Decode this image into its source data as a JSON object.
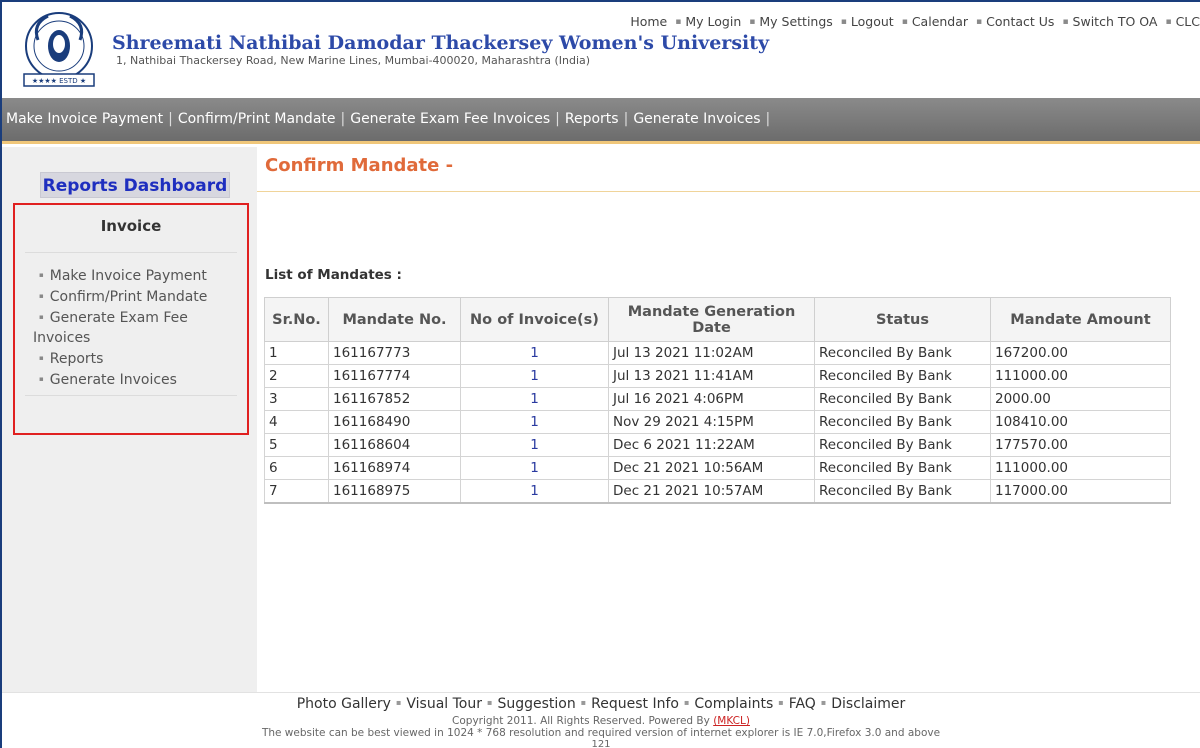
{
  "header": {
    "university_name": "Shreemati Nathibai Damodar Thackersey Women's University",
    "address": "1, Nathibai Thackersey Road, New Marine Lines, Mumbai-400020, Maharashtra (India)",
    "top_links": [
      "Home",
      "My Login",
      "My Settings",
      "Logout",
      "Calendar",
      "Contact Us",
      "Switch TO OA",
      "CLC"
    ]
  },
  "menubar": {
    "items": [
      "Make Invoice Payment",
      "Confirm/Print Mandate",
      "Generate Exam Fee Invoices",
      "Reports",
      "Generate Invoices"
    ]
  },
  "sidebar": {
    "dashboard_label": "Reports Dashboard",
    "section_title": "Invoice",
    "items": [
      "Make Invoice Payment",
      "Confirm/Print Mandate",
      "Generate Exam Fee Invoices",
      "Reports",
      "Generate Invoices"
    ]
  },
  "main": {
    "title": "Confirm Mandate -",
    "list_label": "List of Mandates :",
    "columns": [
      "Sr.No.",
      "Mandate No.",
      "No of Invoice(s)",
      "Mandate Generation Date",
      "Status",
      "Mandate Amount"
    ],
    "rows": [
      [
        "1",
        "161167773",
        "1",
        "Jul 13 2021 11:02AM",
        "Reconciled By Bank",
        "167200.00"
      ],
      [
        "2",
        "161167774",
        "1",
        "Jul 13 2021 11:41AM",
        "Reconciled By Bank",
        "111000.00"
      ],
      [
        "3",
        "161167852",
        "1",
        "Jul 16 2021 4:06PM",
        "Reconciled By Bank",
        "2000.00"
      ],
      [
        "4",
        "161168490",
        "1",
        "Nov 29 2021 4:15PM",
        "Reconciled By Bank",
        "108410.00"
      ],
      [
        "5",
        "161168604",
        "1",
        "Dec 6 2021 11:22AM",
        "Reconciled By Bank",
        "177570.00"
      ],
      [
        "6",
        "161168974",
        "1",
        "Dec 21 2021 10:56AM",
        "Reconciled By Bank",
        "111000.00"
      ],
      [
        "7",
        "161168975",
        "1",
        "Dec 21 2021 10:57AM",
        "Reconciled By Bank",
        "117000.00"
      ]
    ]
  },
  "footer": {
    "links": [
      "Photo Gallery",
      "Visual Tour",
      "Suggestion",
      "Request Info",
      "Complaints",
      "FAQ",
      "Disclaimer"
    ],
    "copyright_prefix": "Copyright 2011. All Rights Reserved. Powered By ",
    "powered_by": "(MKCL)",
    "best_viewed": "The website can be best viewed in 1024 * 768 resolution and required version of internet explorer is IE 7.0,Firefox 3.0 and above",
    "counter": "121"
  },
  "colors": {
    "brand_blue": "#2d4aa8",
    "title_orange": "#e06a3a",
    "menubar_gray": "#7a7a7a",
    "highlight_red": "#e02020"
  }
}
